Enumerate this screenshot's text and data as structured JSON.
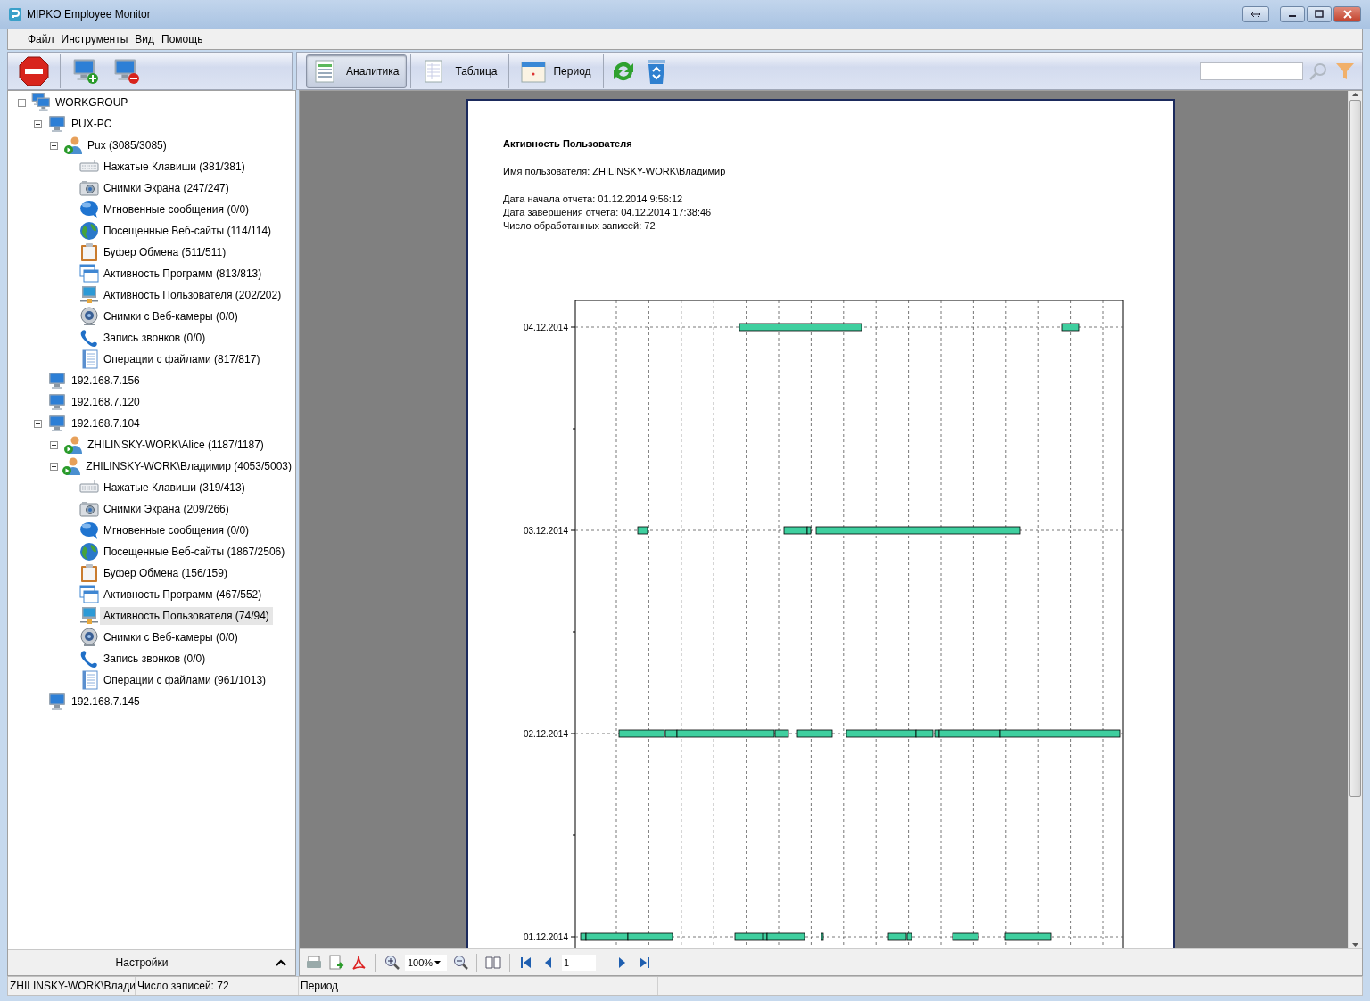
{
  "window": {
    "title": "MIPKO Employee Monitor"
  },
  "menu": [
    "Файл",
    "Инструменты",
    "Вид",
    "Помощь"
  ],
  "toolbar": {
    "views": [
      {
        "label": "Аналитика",
        "selected": true
      },
      {
        "label": "Таблица",
        "selected": false
      },
      {
        "label": "Период",
        "selected": false
      }
    ]
  },
  "tree": [
    {
      "kind": "workgroup",
      "label": "WORKGROUP",
      "expanded": true,
      "selected": false,
      "children": [
        {
          "kind": "computer",
          "label": "PUX-PC",
          "expanded": true,
          "selected": false,
          "children": [
            {
              "kind": "user",
              "label": "Pux (3085/3085)",
              "expanded": true,
              "selected": false,
              "children": [
                {
                  "kind": "keystrokes",
                  "label": "Нажатые Клавиши (381/381)",
                  "selected": false
                },
                {
                  "kind": "screenshots",
                  "label": "Снимки Экрана (247/247)",
                  "selected": false
                },
                {
                  "kind": "messages",
                  "label": "Мгновенные сообщения (0/0)",
                  "selected": false
                },
                {
                  "kind": "websites",
                  "label": "Посещенные Веб-сайты (114/114)",
                  "selected": false
                },
                {
                  "kind": "clipboard",
                  "label": "Буфер Обмена (511/511)",
                  "selected": false
                },
                {
                  "kind": "programs",
                  "label": "Активность Программ (813/813)",
                  "selected": false
                },
                {
                  "kind": "activity",
                  "label": "Активность Пользователя (202/202)",
                  "selected": false
                },
                {
                  "kind": "webcam",
                  "label": "Снимки с Веб-камеры (0/0)",
                  "selected": false
                },
                {
                  "kind": "calls",
                  "label": "Запись звонков (0/0)",
                  "selected": false
                },
                {
                  "kind": "files",
                  "label": "Операции с файлами (817/817)",
                  "selected": false
                }
              ]
            }
          ]
        },
        {
          "kind": "computer",
          "label": "192.168.7.156",
          "selected": false
        },
        {
          "kind": "computer",
          "label": "192.168.7.120",
          "selected": false
        },
        {
          "kind": "computer",
          "label": "192.168.7.104",
          "expanded": true,
          "selected": false,
          "children": [
            {
              "kind": "user",
              "label": "ZHILINSKY-WORK\\Alice (1187/1187)",
              "expanded": false,
              "selected": false
            },
            {
              "kind": "user",
              "label": "ZHILINSKY-WORK\\Владимир (4053/5003)",
              "expanded": true,
              "selected": false,
              "children": [
                {
                  "kind": "keystrokes",
                  "label": "Нажатые Клавиши (319/413)",
                  "selected": false
                },
                {
                  "kind": "screenshots",
                  "label": "Снимки Экрана (209/266)",
                  "selected": false
                },
                {
                  "kind": "messages",
                  "label": "Мгновенные сообщения (0/0)",
                  "selected": false
                },
                {
                  "kind": "websites",
                  "label": "Посещенные Веб-сайты (1867/2506)",
                  "selected": false
                },
                {
                  "kind": "clipboard",
                  "label": "Буфер Обмена (156/159)",
                  "selected": false
                },
                {
                  "kind": "programs",
                  "label": "Активность Программ (467/552)",
                  "selected": false
                },
                {
                  "kind": "activity",
                  "label": "Активность Пользователя (74/94)",
                  "selected": true
                },
                {
                  "kind": "webcam",
                  "label": "Снимки с Веб-камеры (0/0)",
                  "selected": false
                },
                {
                  "kind": "calls",
                  "label": "Запись звонков (0/0)",
                  "selected": false
                },
                {
                  "kind": "files",
                  "label": "Операции с файлами (961/1013)",
                  "selected": false
                }
              ]
            }
          ]
        },
        {
          "kind": "computer",
          "label": "192.168.7.145",
          "selected": false
        }
      ]
    }
  ],
  "settings_panel": {
    "label": "Настройки"
  },
  "report": {
    "title": "Активность Пользователя",
    "user_line": "Имя пользователя: ZHILINSKY-WORK\\Владимир",
    "info_lines": [
      "Дата начала отчета: 01.12.2014 9:56:12",
      "Дата завершения отчета: 04.12.2014 17:38:46",
      "Число обработанных записей: 72"
    ],
    "timeline": {
      "rows": [
        "04.12.2014",
        "03.12.2014",
        "02.12.2014",
        "01.12.2014"
      ]
    }
  },
  "preview_toolbar": {
    "zoom": "100%",
    "page": "1"
  },
  "status_bar": [
    "ZHILINSKY-WORK\\Влади",
    "Число записей: 72",
    "Период"
  ]
}
